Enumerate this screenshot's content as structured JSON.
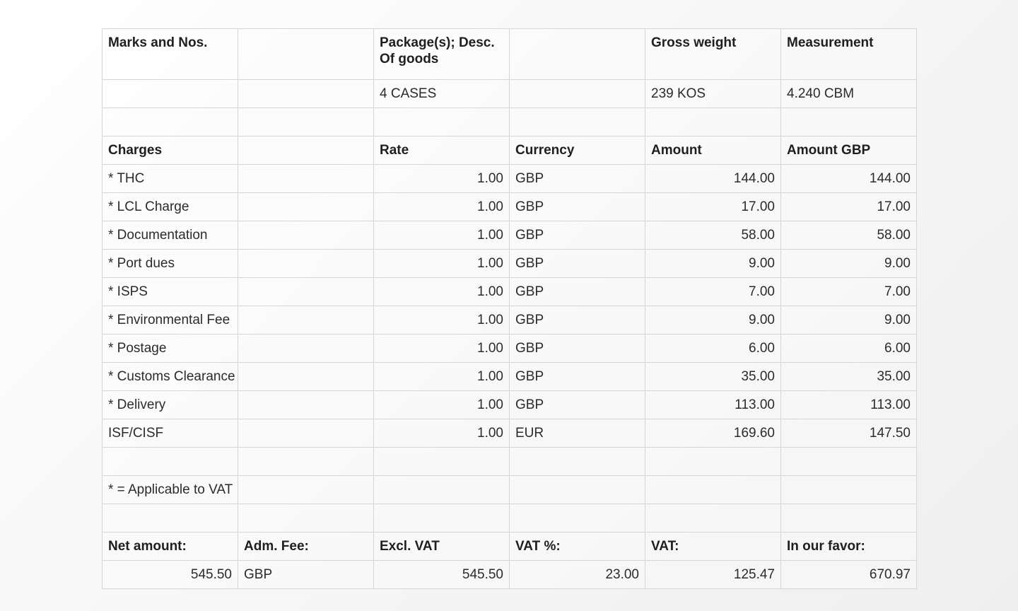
{
  "shipment_header": {
    "marks": "Marks and Nos.",
    "packages": "Package(s); Desc. Of goods",
    "gross_weight": "Gross weight",
    "measurement": "Measurement"
  },
  "shipment_values": {
    "packages": "4 CASES",
    "gross_weight": "239 KOS",
    "measurement": "4.240 CBM"
  },
  "charges_header": {
    "charges": "Charges",
    "rate": "Rate",
    "currency": "Currency",
    "amount": "Amount",
    "amount_gbp": "Amount GBP"
  },
  "charges": [
    {
      "name": "* THC",
      "rate": "1.00",
      "currency": "GBP",
      "amount": "144.00",
      "amount_gbp": "144.00"
    },
    {
      "name": "* LCL Charge",
      "rate": "1.00",
      "currency": "GBP",
      "amount": "17.00",
      "amount_gbp": "17.00"
    },
    {
      "name": "* Documentation",
      "rate": "1.00",
      "currency": "GBP",
      "amount": "58.00",
      "amount_gbp": "58.00"
    },
    {
      "name": "* Port dues",
      "rate": "1.00",
      "currency": "GBP",
      "amount": "9.00",
      "amount_gbp": "9.00"
    },
    {
      "name": "* ISPS",
      "rate": "1.00",
      "currency": "GBP",
      "amount": "7.00",
      "amount_gbp": "7.00"
    },
    {
      "name": "* Environmental Fee",
      "rate": "1.00",
      "currency": "GBP",
      "amount": "9.00",
      "amount_gbp": "9.00"
    },
    {
      "name": "* Postage",
      "rate": "1.00",
      "currency": "GBP",
      "amount": "6.00",
      "amount_gbp": "6.00"
    },
    {
      "name": "* Customs Clearance",
      "rate": "1.00",
      "currency": "GBP",
      "amount": "35.00",
      "amount_gbp": "35.00"
    },
    {
      "name": "* Delivery",
      "rate": "1.00",
      "currency": "GBP",
      "amount": "113.00",
      "amount_gbp": "113.00"
    },
    {
      "name": "ISF/CISF",
      "rate": "1.00",
      "currency": "EUR",
      "amount": "169.60",
      "amount_gbp": "147.50"
    }
  ],
  "vat_note": "* = Applicable to VAT",
  "totals_header": {
    "net_amount": "Net amount:",
    "adm_fee": "Adm. Fee:",
    "excl_vat": "Excl. VAT",
    "vat_percent": "VAT %:",
    "vat": "VAT:",
    "in_our_favor": "In our favor:"
  },
  "totals": {
    "net_amount": "545.50",
    "adm_fee": "GBP",
    "excl_vat": "545.50",
    "vat_percent": "23.00",
    "vat": "125.47",
    "in_our_favor": "670.97"
  }
}
